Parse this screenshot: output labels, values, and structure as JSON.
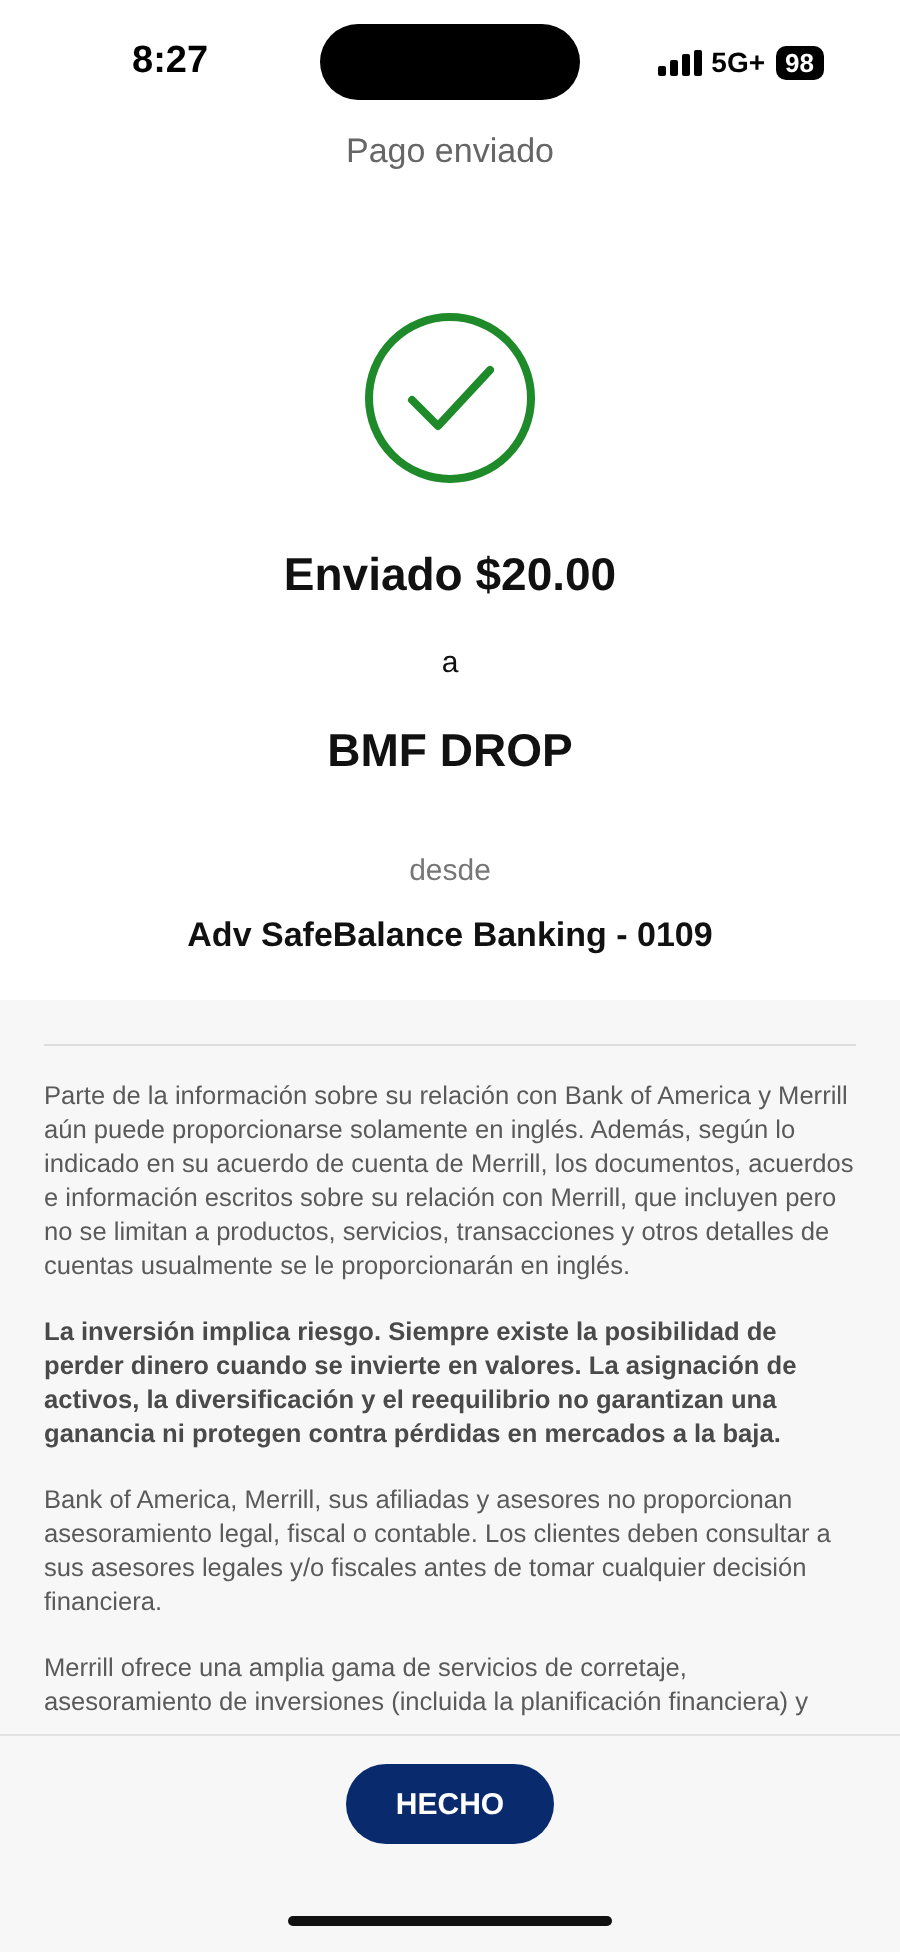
{
  "status_bar": {
    "time": "8:27",
    "network": "5G+",
    "battery": "98"
  },
  "header": {
    "title": "Pago enviado"
  },
  "confirmation": {
    "amount_line": "Enviado $20.00",
    "connector": "a",
    "recipient": "BMF DROP",
    "from_label": "desde",
    "account": "Adv SafeBalance Banking - 0109"
  },
  "disclaimer": [
    {
      "kind": "plain",
      "text": "Parte de la información sobre su relación con Bank of America y Merrill aún puede proporcionarse solamente en inglés. Además, según lo indicado en su acuerdo de cuenta de Merrill, los documentos, acuerdos e información escritos sobre su relación con Merrill, que incluyen pero no se limitan a productos, servicios, transacciones y otros detalles de cuentas usualmente se le proporcionarán en inglés."
    },
    {
      "kind": "bold",
      "text": "La inversión implica riesgo. Siempre existe la posibilidad de perder dinero cuando se invierte en valores. La asignación de activos, la diversificación y el reequilibrio no garantizan una ganancia ni protegen contra pérdidas en mercados a la baja."
    },
    {
      "kind": "plain",
      "text": "Bank of America, Merrill, sus afiliadas y asesores no proporcionan asesoramiento legal, fiscal o contable. Los clientes deben consultar a sus asesores legales y/o fiscales antes de tomar cualquier decisión financiera."
    },
    {
      "kind": "plain",
      "text": "Merrill ofrece una amplia gama de servicios de corretaje, asesoramiento de inversiones (incluida la planificación financiera) y"
    }
  ],
  "footer": {
    "button": "HECHO"
  }
}
